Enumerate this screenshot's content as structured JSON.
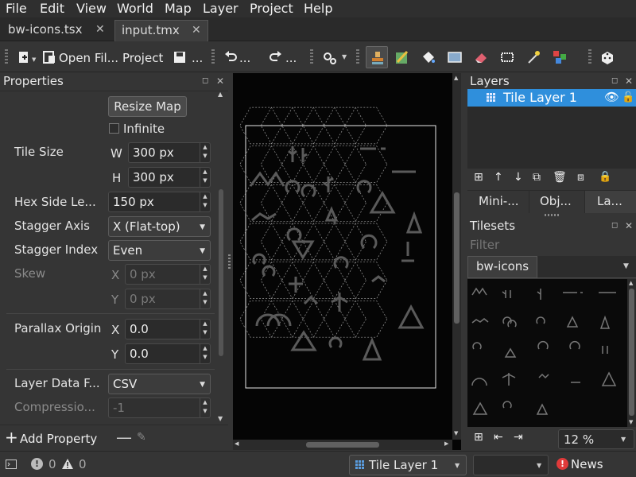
{
  "menu": [
    "File",
    "Edit",
    "View",
    "World",
    "Map",
    "Layer",
    "Project",
    "Help"
  ],
  "tabs": [
    {
      "label": "bw-icons.tsx",
      "active": false
    },
    {
      "label": "input.tmx",
      "active": true
    }
  ],
  "toolbar": {
    "open_label": "Open Fil...",
    "project_label": "Project",
    "undo_label": "...",
    "redo_label": "..."
  },
  "properties": {
    "title": "Properties",
    "resize_button": "Resize Map",
    "infinite_label": "Infinite",
    "infinite_checked": false,
    "tile_size_label": "Tile Size",
    "w_label": "W",
    "w_value": "300 px",
    "h_label": "H",
    "h_value": "300 px",
    "hex_side_label": "Hex Side Le...",
    "hex_side_value": "150 px",
    "stagger_axis_label": "Stagger Axis",
    "stagger_axis_value": "X (Flat-top)",
    "stagger_index_label": "Stagger Index",
    "stagger_index_value": "Even",
    "skew_label": "Skew",
    "skew_x_label": "X",
    "skew_x_value": "0 px",
    "skew_y_label": "Y",
    "skew_y_value": "0 px",
    "parallax_label": "Parallax Origin",
    "par_x_label": "X",
    "par_x_value": "0.0",
    "par_y_label": "Y",
    "par_y_value": "0.0",
    "layer_format_label": "Layer Data F...",
    "layer_format_value": "CSV",
    "compression_label": "Compressio...",
    "compression_value": "-1",
    "add_property_label": "Add Property"
  },
  "layers": {
    "title": "Layers",
    "items": [
      {
        "label": "Tile Layer 1",
        "selected": true,
        "visible": true
      }
    ],
    "tabs": [
      "Mini-...",
      "Obj...",
      "La..."
    ]
  },
  "tilesets": {
    "title": "Tilesets",
    "filter_placeholder": "Filter",
    "tab": "bw-icons",
    "zoom": "12 %"
  },
  "status": {
    "errors": "0",
    "warnings": "0",
    "layer_select": "Tile Layer 1",
    "news_label": "News"
  },
  "colors": {
    "selection": "#2f8fdc",
    "background": "#353535",
    "canvas": "#050505",
    "news_icon": "#e03a3a"
  }
}
